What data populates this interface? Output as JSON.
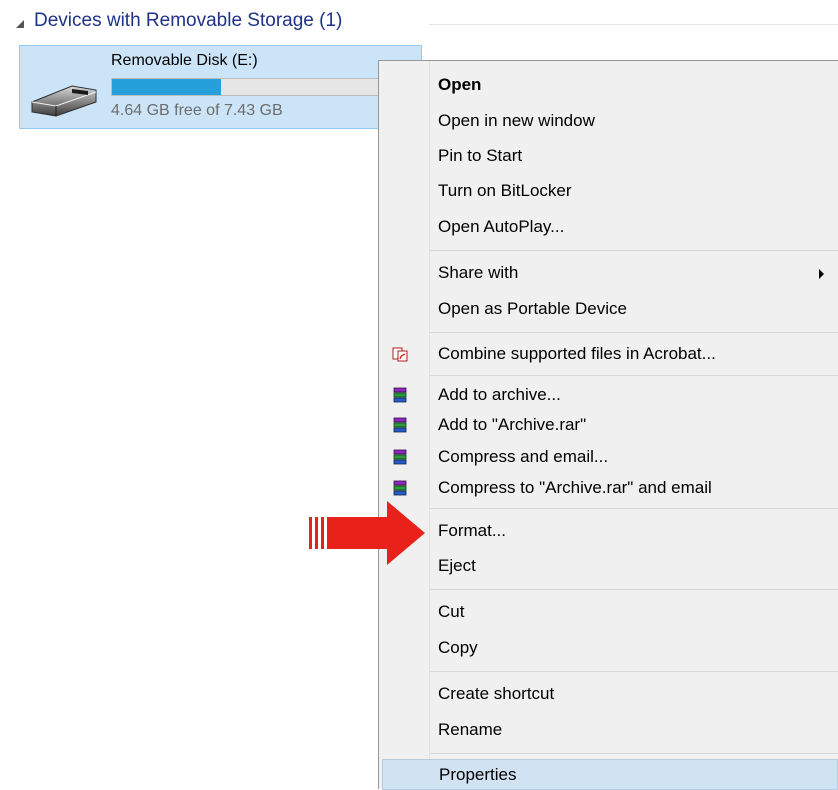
{
  "group": {
    "title": "Devices with Removable Storage (1)"
  },
  "drive": {
    "name": "Removable Disk (E:)",
    "space": "4.64 GB free of 7.43 GB",
    "used_fraction": 0.38,
    "bar_color": "#26a0da",
    "icon": "usb-drive-icon"
  },
  "menu": {
    "items": [
      {
        "label": "Open",
        "bold": true
      },
      {
        "label": "Open in new window"
      },
      {
        "label": "Pin to Start"
      },
      {
        "label": "Turn on BitLocker"
      },
      {
        "label": "Open AutoPlay..."
      },
      {
        "label": "Share with",
        "submenu": true
      },
      {
        "label": "Open as Portable Device"
      },
      {
        "label": "Combine supported files in Acrobat...",
        "icon": "acrobat-icon"
      },
      {
        "label": "Add to archive...",
        "icon": "winrar-icon"
      },
      {
        "label": "Add to \"Archive.rar\"",
        "icon": "winrar-icon"
      },
      {
        "label": "Compress and email...",
        "icon": "winrar-icon"
      },
      {
        "label": "Compress to \"Archive.rar\" and email",
        "icon": "winrar-icon"
      },
      {
        "label": "Format..."
      },
      {
        "label": "Eject"
      },
      {
        "label": "Cut"
      },
      {
        "label": "Copy"
      },
      {
        "label": "Create shortcut"
      },
      {
        "label": "Rename"
      },
      {
        "label": "Properties",
        "highlighted": true
      }
    ]
  },
  "annotation": {
    "arrow_icon": "red-arrow-icon",
    "arrow_color": "#e8221b",
    "points_to": "Format..."
  }
}
